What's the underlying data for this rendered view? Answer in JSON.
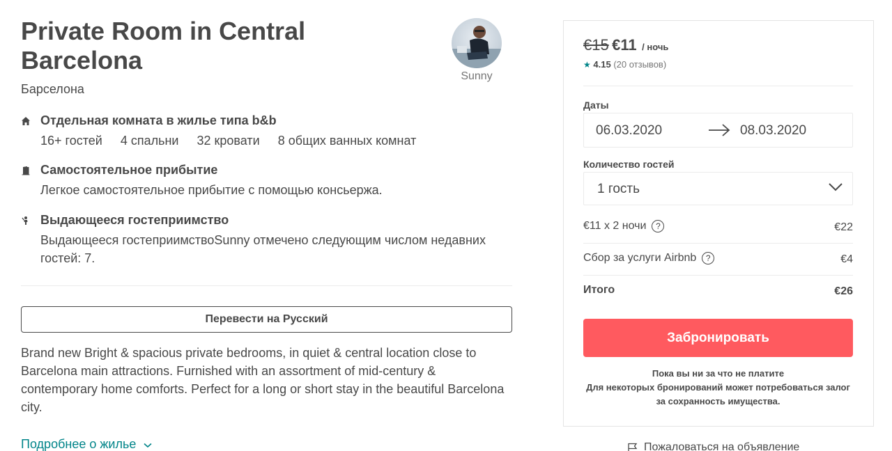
{
  "listing": {
    "title": "Private Room in Central Barcelona",
    "city": "Барселона",
    "host_name": "Sunny"
  },
  "features": [
    {
      "icon": "home-icon",
      "heading": "Отдельная комната в жилье типа b&b",
      "stats": [
        "16+ гостей",
        "4 спальни",
        "32 кровати",
        "8 общих ванных комнат"
      ]
    },
    {
      "icon": "door-icon",
      "heading": "Самостоятельное прибытие",
      "body": "Легкое самостоятельное прибытие с помощью консьержа."
    },
    {
      "icon": "host-icon",
      "heading": "Выдающееся гостеприимство",
      "body": "Выдающееся гостеприимствоSunny отмечено следующим числом недавних гостей: 7."
    }
  ],
  "translate_button": "Перевести на Русский",
  "description": "Brand new Bright & spacious private bedrooms, in quiet & central location close to Barcelona main attractions. Furnished with an assortment of mid-century & contemporary home comforts. Perfect for a long or short stay in the beautiful Barcelona city.",
  "more_link": "Подробнее о жилье",
  "booking": {
    "old_price": "€15",
    "new_price": "€11",
    "per_night": "/ ночь",
    "rating_score": "4.15",
    "rating_reviews": "(20 отзывов)",
    "dates_label": "Даты",
    "check_in": "06.03.2020",
    "check_out": "08.03.2020",
    "guests_label": "Количество гостей",
    "guests_value": "1 гость",
    "nights_label": "€11 x 2 ночи",
    "nights_value": "€22",
    "fee_label": "Сбор за услуги Airbnb",
    "fee_value": "€4",
    "total_label": "Итого",
    "total_value": "€26",
    "book_button": "Забронировать",
    "note_line1": "Пока вы ни за что не платите",
    "note_line2": "Для некоторых бронирований может потребоваться залог за сохранность имущества."
  },
  "report_link": "Пожаловаться на объявление",
  "colors": {
    "accent": "#ff5a5f",
    "link": "#008489",
    "text": "#484848"
  }
}
